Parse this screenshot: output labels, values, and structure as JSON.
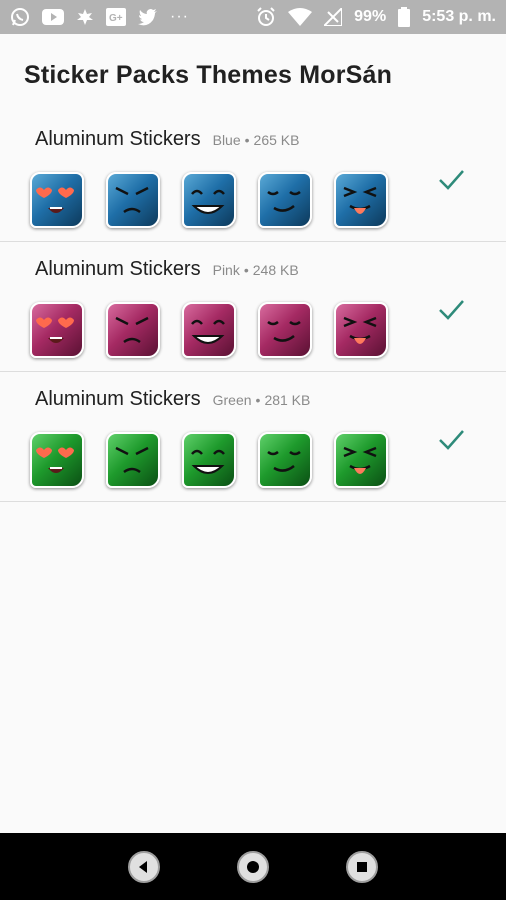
{
  "status_bar": {
    "battery": "99%",
    "time": "5:53 p. m.",
    "left_icons": [
      "whatsapp-icon",
      "youtube-icon",
      "leaf-icon",
      "google-plus-icon",
      "twitter-icon",
      "more-dots-icon"
    ],
    "right_icons": [
      "alarm-icon",
      "wifi-icon",
      "no-signal-icon",
      "battery-icon"
    ],
    "dots": "···"
  },
  "app_bar": {
    "title": "Sticker Packs Themes MorSán"
  },
  "packs": [
    {
      "name": "Aluminum Stickers",
      "color_name": "Blue",
      "separator": "•",
      "size": "265 KB",
      "added": true,
      "accent": "#1f6fa8",
      "light": "#5aa9d6",
      "dark": "#0d3a5c"
    },
    {
      "name": "Aluminum Stickers",
      "color_name": "Pink",
      "separator": "•",
      "size": "248 KB",
      "added": true,
      "accent": "#a52a63",
      "light": "#d86b9e",
      "dark": "#5a1133"
    },
    {
      "name": "Aluminum Stickers",
      "color_name": "Green",
      "separator": "•",
      "size": "281 KB",
      "added": true,
      "accent": "#1e9a2c",
      "light": "#5fd06a",
      "dark": "#0b5014"
    }
  ],
  "sticker_faces": [
    "heart-eyes-face-icon",
    "angry-face-icon",
    "grinning-face-icon",
    "smirk-face-icon",
    "tongue-out-face-icon"
  ],
  "colors": {
    "check": "#2e8b7a",
    "status_bar": "#b3b3b3"
  },
  "nav_bar": {
    "buttons": [
      "back-button",
      "home-button",
      "recents-button"
    ]
  }
}
